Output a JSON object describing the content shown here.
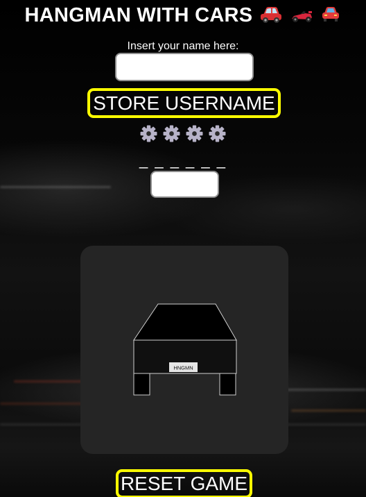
{
  "header": {
    "title": "HANGMAN WITH CARS",
    "title_icons": [
      "red-car-icon",
      "race-car-icon",
      "blue-car-icon"
    ]
  },
  "username": {
    "label": "Insert your name here:",
    "value": "",
    "placeholder": "",
    "store_button_label": "STORE USERNAME"
  },
  "lives": {
    "icon": "gear-icon",
    "count": 4
  },
  "game": {
    "word_display": "_ _ _ _ _ _",
    "letter_value": "",
    "car": {
      "plate_text": "HNGMN"
    },
    "reset_button_label": "RESET GAME"
  },
  "colors": {
    "accent_border": "#ffff00",
    "panel_bg": "#252525",
    "gear": "#b7b3c8"
  }
}
